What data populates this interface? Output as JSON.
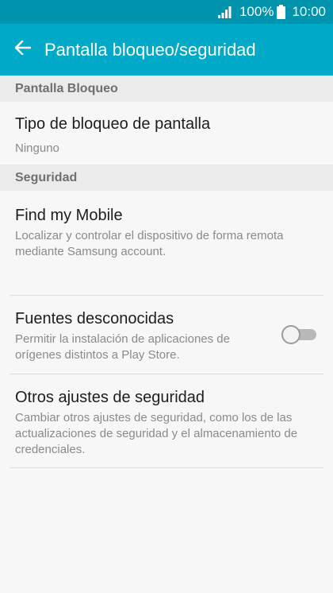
{
  "status_bar": {
    "battery_percent": "100%",
    "time": "10:00",
    "signal_icon": "signal-bars-icon",
    "battery_icon": "battery-icon"
  },
  "app_bar": {
    "back_icon": "arrow-left-icon",
    "title": "Pantalla bloqueo/seguridad",
    "color": "#00a9c8"
  },
  "sections": {
    "lock_screen": {
      "header": "Pantalla Bloqueo",
      "items": [
        {
          "title": "Tipo de bloqueo de pantalla",
          "summary": "Ninguno"
        }
      ]
    },
    "security": {
      "header": "Seguridad",
      "items": [
        {
          "title": "Find my Mobile",
          "summary": "Localizar y controlar el dispositivo de forma remota mediante Samsung account."
        },
        {
          "title": "Fuentes desconocidas",
          "summary": "Permitir la instalación de aplicaciones de orígenes distintos a Play Store.",
          "toggle_on": false
        },
        {
          "title": "Otros ajustes de seguridad",
          "summary": "Cambiar otros ajustes de seguridad, como los de las actualizaciones de seguridad y el almacenamiento de credenciales."
        }
      ]
    }
  }
}
